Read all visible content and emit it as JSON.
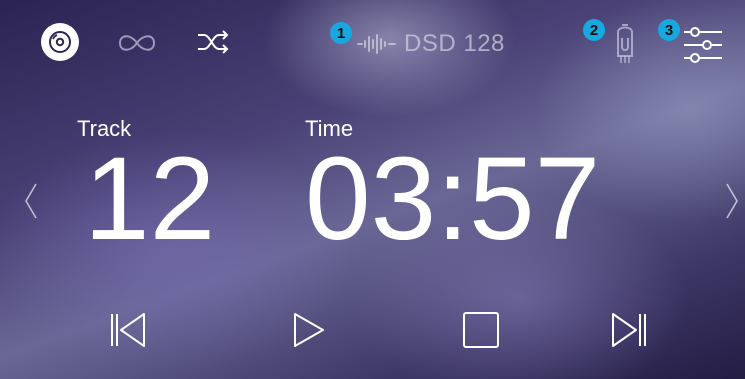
{
  "header": {
    "format_text": "DSD 128",
    "badges": [
      "1",
      "2",
      "3"
    ]
  },
  "display": {
    "track_label": "Track",
    "track_number": "12",
    "time_label": "Time",
    "time_value": "03:57"
  },
  "icons": {
    "source": "disc-icon",
    "repeat": "infinity-repeat-icon",
    "shuffle": "shuffle-icon",
    "waveform": "waveform-icon",
    "tube": "vacuum-tube-icon",
    "settings": "sliders-icon",
    "prev_nav": "chevron-left-icon",
    "next_nav": "chevron-right-icon",
    "previous": "skip-previous-icon",
    "play": "play-icon",
    "stop": "stop-icon",
    "next": "skip-next-icon"
  },
  "colors": {
    "badge": "#17a8e0",
    "foreground": "#ffffff"
  }
}
